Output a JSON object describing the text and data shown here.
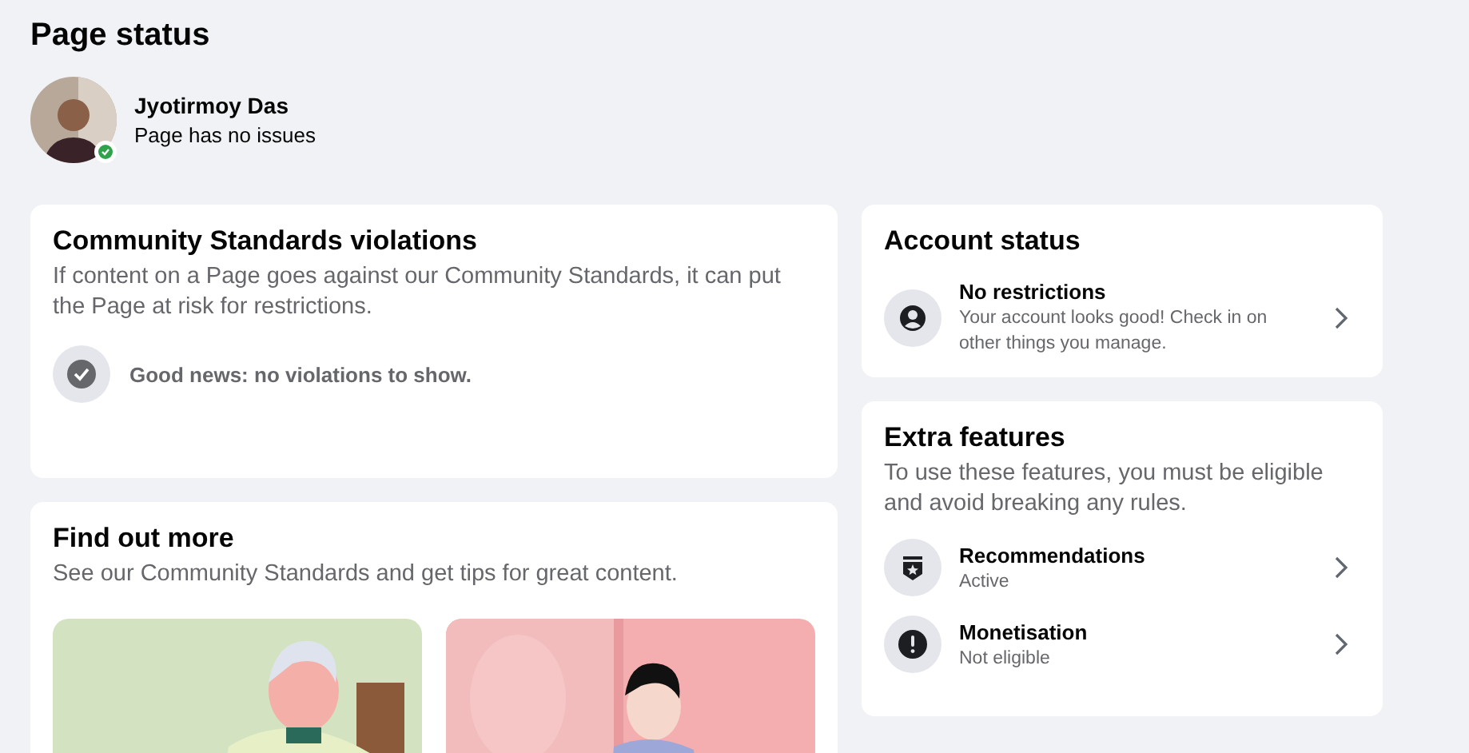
{
  "page": {
    "title": "Page status"
  },
  "profile": {
    "name": "Jyotirmoy Das",
    "status": "Page has no issues"
  },
  "violations": {
    "title": "Community Standards violations",
    "description": "If content on a Page goes against our Community Standards, it can put the Page at risk for restrictions.",
    "message": "Good news: no violations to show."
  },
  "find_out_more": {
    "title": "Find out more",
    "description": "See our Community Standards and get tips for great content."
  },
  "account_status": {
    "title": "Account status",
    "items": [
      {
        "kind": "account",
        "title": "No restrictions",
        "subtitle": "Your account looks good! Check in on other things you manage."
      }
    ]
  },
  "extra_features": {
    "title": "Extra features",
    "description": "To use these features, you must be eligible and avoid breaking any rules.",
    "items": [
      {
        "kind": "badge",
        "title": "Recommendations",
        "subtitle": "Active"
      },
      {
        "kind": "alert",
        "title": "Monetisation",
        "subtitle": "Not eligible"
      }
    ]
  }
}
